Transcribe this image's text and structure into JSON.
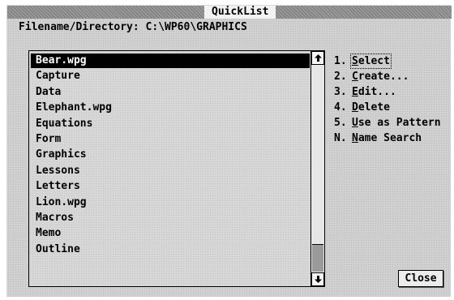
{
  "window": {
    "title": "QuickList"
  },
  "filename": {
    "label": "Filename/Directory:",
    "value": "C:\\WP60\\GRAPHICS"
  },
  "file_list": {
    "items": [
      "Bear.wpg",
      "Capture",
      "Data",
      "Elephant.wpg",
      "Equations",
      "Form",
      "Graphics",
      "Lessons",
      "Letters",
      "Lion.wpg",
      "Macros",
      "Memo",
      "Outline"
    ],
    "selected": "Bear.wpg"
  },
  "scrollbar": {
    "up_icon": "arrow-up",
    "down_icon": "arrow-down",
    "thumb_fraction": 0.87
  },
  "actions": [
    {
      "key": "1.",
      "before": "",
      "hotkey": "S",
      "after": "elect"
    },
    {
      "key": "2.",
      "before": "",
      "hotkey": "C",
      "after": "reate..."
    },
    {
      "key": "3.",
      "before": "",
      "hotkey": "E",
      "after": "dit..."
    },
    {
      "key": "4.",
      "before": "",
      "hotkey": "D",
      "after": "elete"
    },
    {
      "key": "5.",
      "before": "",
      "hotkey": "U",
      "after": "se as Pattern"
    },
    {
      "key": "N.",
      "before": "",
      "hotkey": "N",
      "after": "ame Search"
    }
  ],
  "close_label": "Close"
}
